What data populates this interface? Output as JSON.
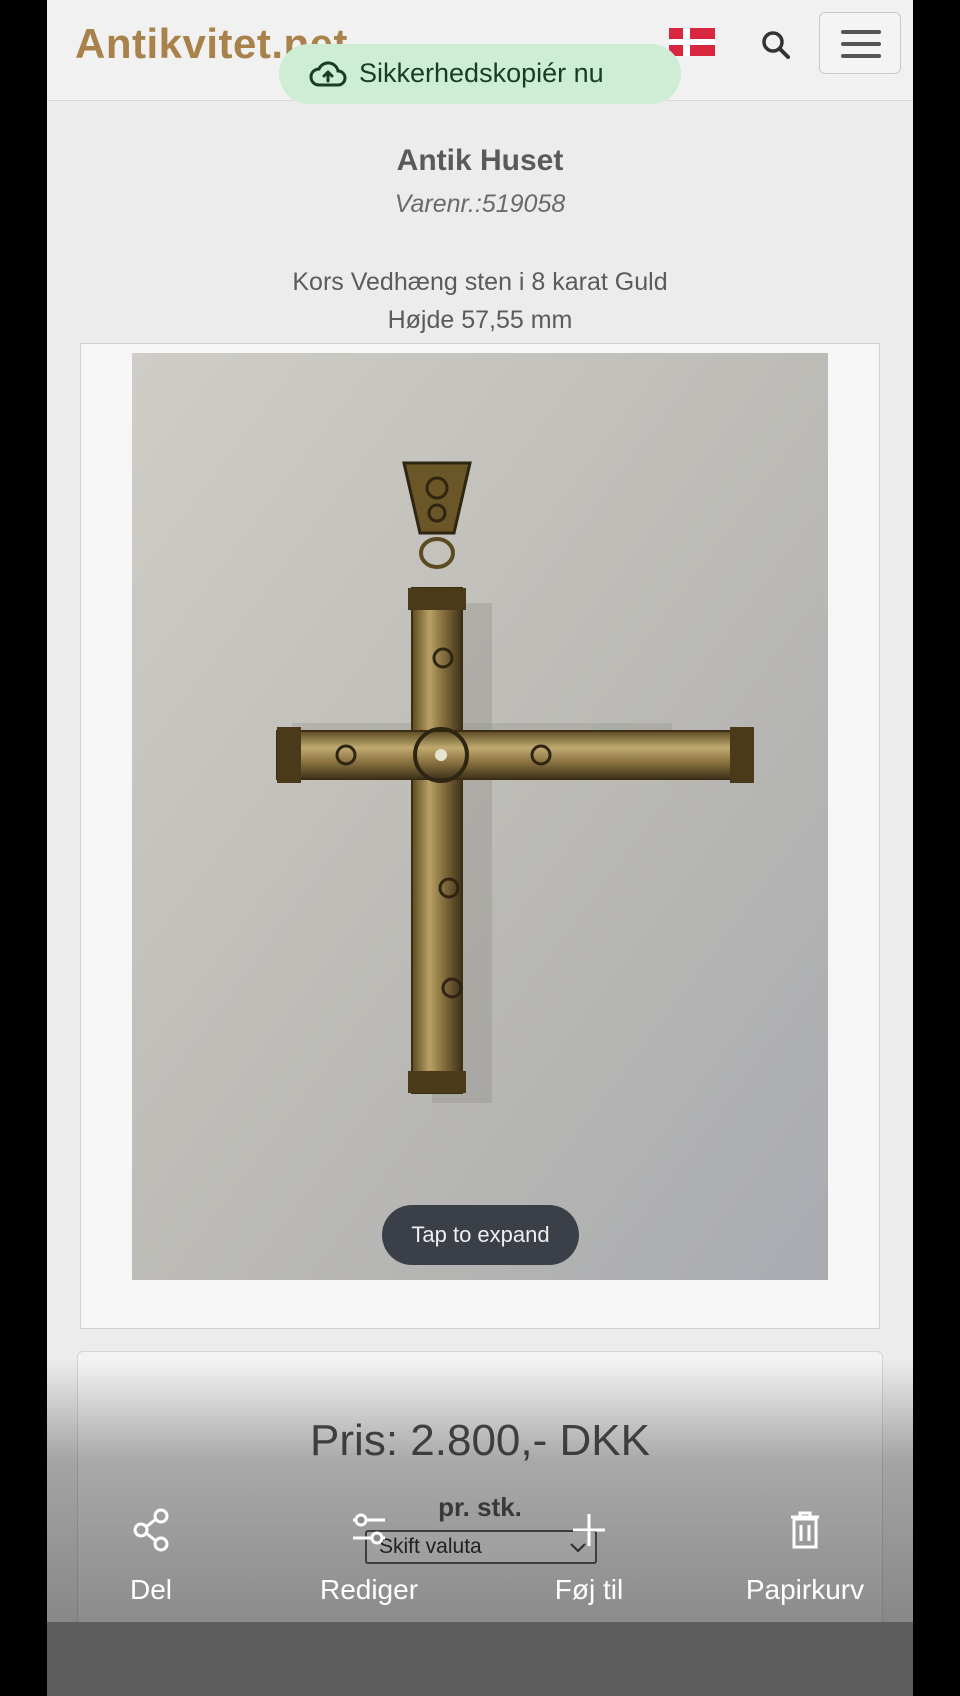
{
  "header": {
    "logo": "Antikvitet.net",
    "language_flag": "danish-flag",
    "search_icon": "search-icon",
    "menu_icon": "hamburger-menu-icon"
  },
  "toast": {
    "label": "Sikkerhedskopiér nu",
    "icon": "cloud-upload-icon"
  },
  "product": {
    "store": "Antik Huset",
    "item_number": "Varenr.:519058",
    "description_line1": "Kors Vedhæng sten i 8 karat Guld",
    "description_line2": "Højde 57,55 mm",
    "image_hint": "Tap to expand",
    "price": "Pris: 2.800,- DKK",
    "unit": "pr. stk.",
    "currency_select": "Skift valuta"
  },
  "actions": [
    {
      "label": "Del",
      "icon": "share-icon"
    },
    {
      "label": "Rediger",
      "icon": "edit-sliders-icon"
    },
    {
      "label": "Føj til",
      "icon": "plus-icon"
    },
    {
      "label": "Papirkurv",
      "icon": "trash-icon"
    }
  ],
  "colors": {
    "logo": "#a9814a",
    "toast_bg": "#cdeed5",
    "flag_red": "#d7263d"
  }
}
